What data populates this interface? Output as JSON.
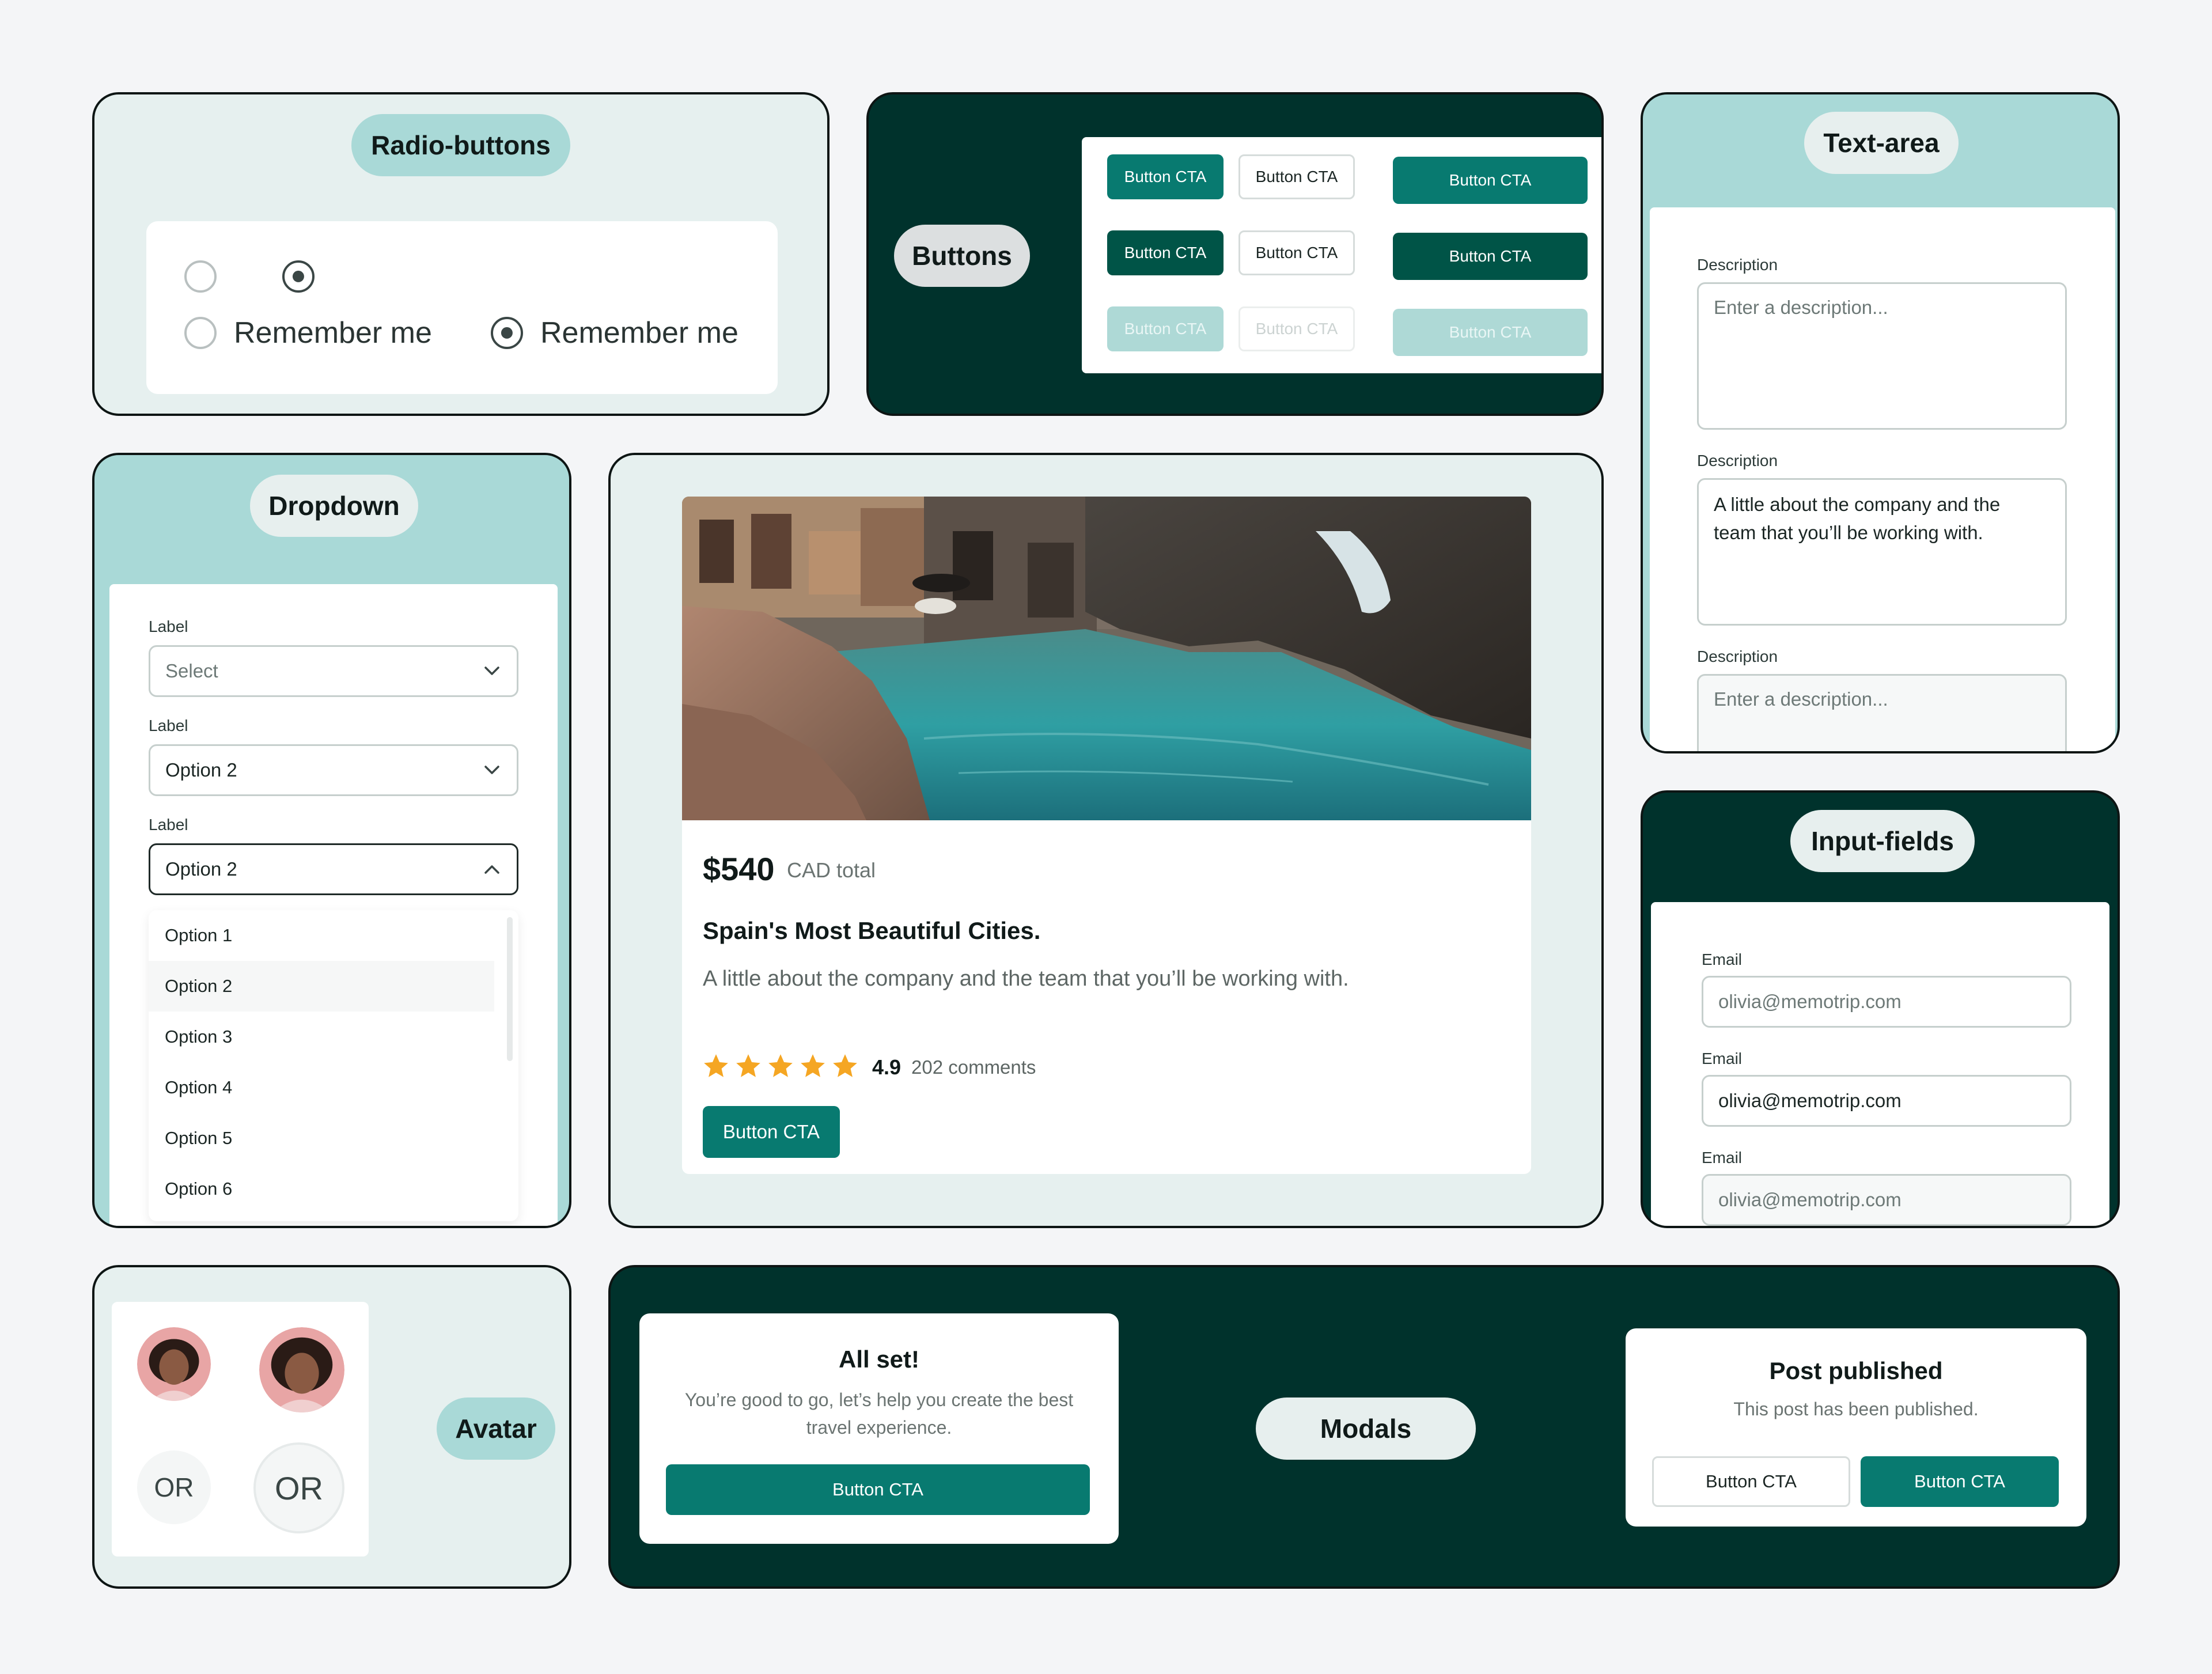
{
  "radio": {
    "pill": "Radio-buttons",
    "options": [
      {
        "label": "Remember me",
        "checked": false
      },
      {
        "label": "Remember me",
        "checked": true
      }
    ]
  },
  "buttons": {
    "pill": "Buttons",
    "label": "Button CTA",
    "colors": {
      "teal": "#087a70",
      "dark": "#005447",
      "faded": "#aed9d6"
    }
  },
  "textarea": {
    "pill": "Text-area",
    "fields": [
      {
        "label": "Description",
        "placeholder": "Enter a description...",
        "value": ""
      },
      {
        "label": "Description",
        "placeholder": "",
        "value": "A little about the company and the team that you’ll be working with."
      },
      {
        "label": "Description",
        "placeholder": "Enter a description...",
        "value": ""
      }
    ]
  },
  "dropdown": {
    "pill": "Dropdown",
    "fields": [
      {
        "label": "Label",
        "value": "Select"
      },
      {
        "label": "Label",
        "value": "Option 2"
      },
      {
        "label": "Label",
        "value": "Option 2"
      }
    ],
    "options": [
      "Option 1",
      "Option 2",
      "Option 3",
      "Option 4",
      "Option 5",
      "Option 6"
    ],
    "selected_option": "Option 2"
  },
  "product": {
    "price": "$540",
    "price_suffix": "CAD total",
    "title": "Spain's Most Beautiful Cities.",
    "description": "A little about the company and the team that you’ll be working with.",
    "rating": "4.9",
    "rating_stars": 5,
    "comments": "202 comments",
    "cta": "Button CTA",
    "star_color": "#f5a623"
  },
  "inputs": {
    "pill": "Input-fields",
    "fields": [
      {
        "label": "Email",
        "value": "olivia@memotrip.com",
        "state": "placeholder"
      },
      {
        "label": "Email",
        "value": "olivia@memotrip.com",
        "state": "filled"
      },
      {
        "label": "Email",
        "value": "olivia@memotrip.com",
        "state": "disabled"
      }
    ]
  },
  "avatar": {
    "pill": "Avatar",
    "initials": "OR"
  },
  "modals": {
    "pill": "Modals",
    "modal1": {
      "title": "All set!",
      "body": "You’re good to go, let’s help you create the best travel experience.",
      "cta": "Button CTA"
    },
    "modal2": {
      "title": "Post published",
      "body": "This post has been published.",
      "secondary": "Button CTA",
      "primary": "Button CTA"
    }
  }
}
